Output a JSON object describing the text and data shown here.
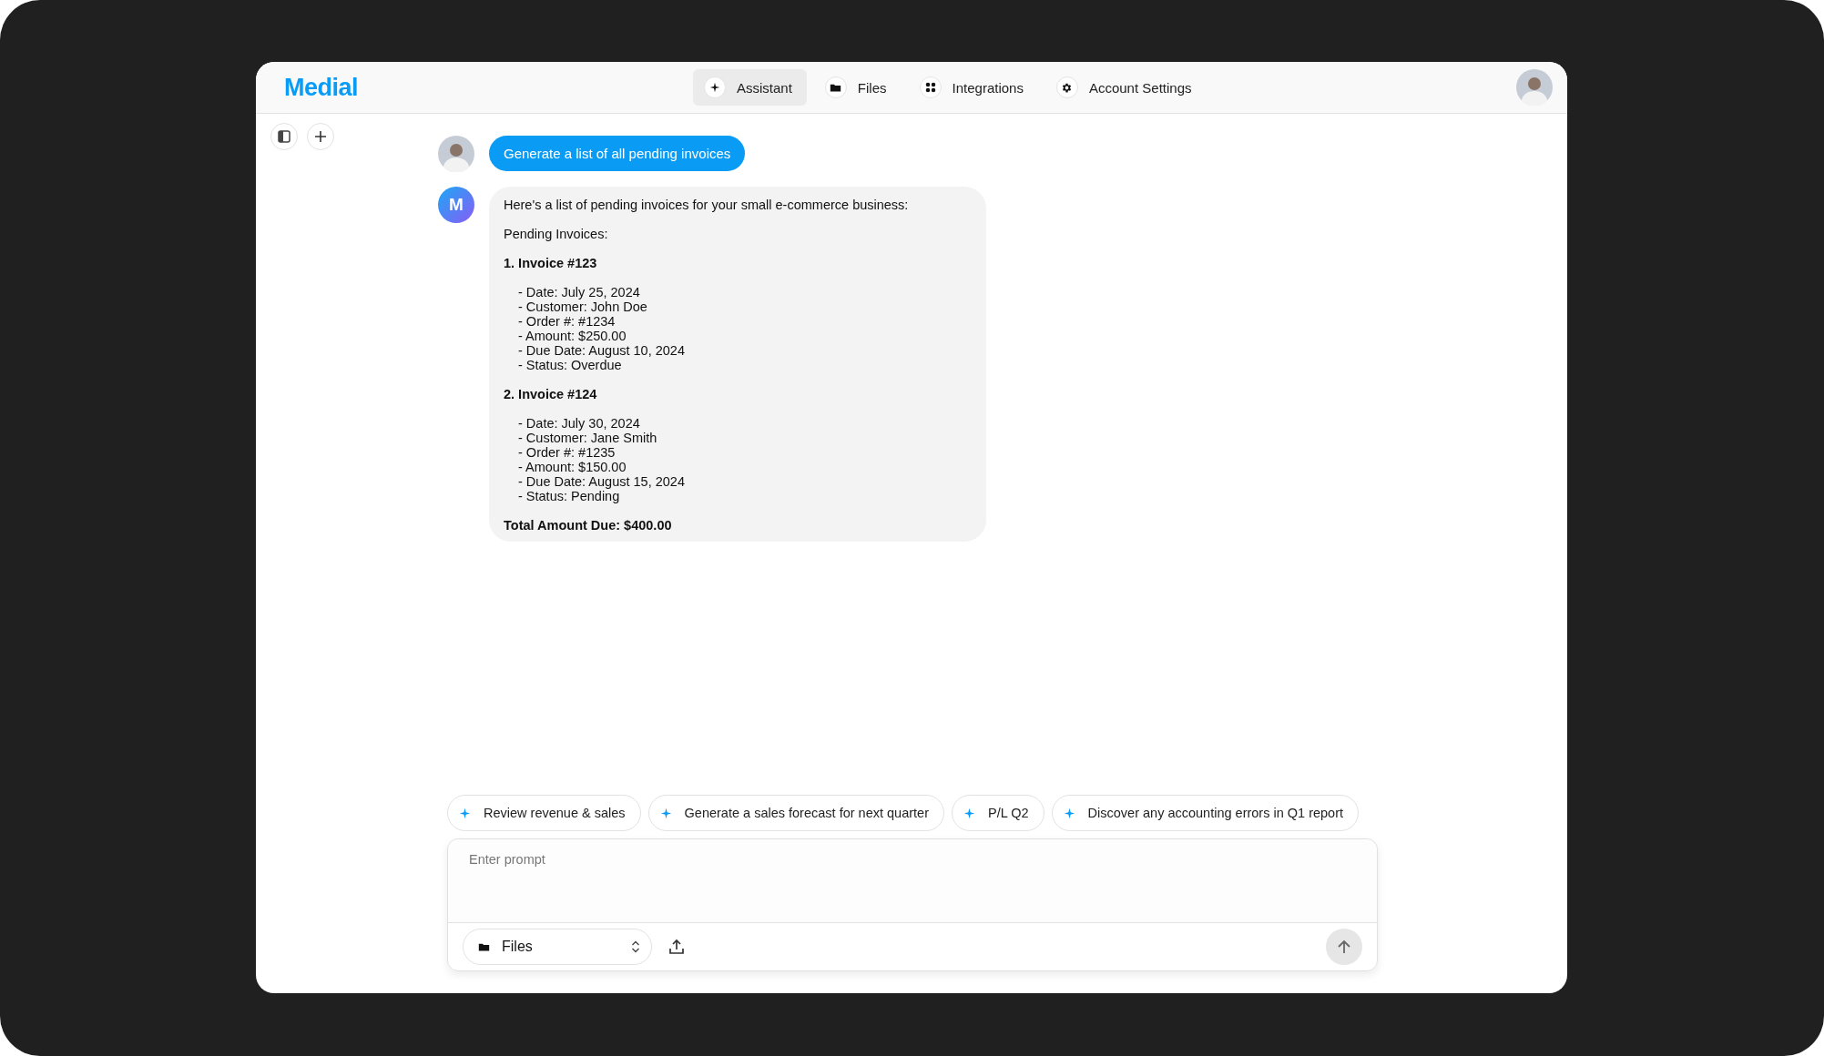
{
  "header": {
    "logo": "Medial",
    "nav": [
      {
        "label": "Assistant",
        "kind": "sparkle",
        "selected": true
      },
      {
        "label": "Files",
        "kind": "folder",
        "selected": false
      },
      {
        "label": "Integrations",
        "kind": "grid",
        "selected": false
      },
      {
        "label": "Account Settings",
        "kind": "gear",
        "selected": false
      }
    ]
  },
  "messages": [
    {
      "kind": "user",
      "text": "Generate a list of all pending invoices"
    },
    {
      "kind": "assistant",
      "avatar": "M",
      "blocks": [
        {
          "kind": "text",
          "text": "Here's a list of pending invoices for your small e-commerce business:"
        },
        {
          "kind": "text",
          "text": "Pending Invoices:"
        },
        {
          "kind": "heading",
          "text": "1. Invoice #123"
        },
        {
          "kind": "list",
          "items": [
            "- Date: July 25, 2024",
            "- Customer: John Doe",
            "- Order #: #1234",
            "- Amount: $250.00",
            "- Due Date: August 10, 2024",
            "- Status: Overdue"
          ]
        },
        {
          "kind": "heading",
          "text": "2. Invoice #124"
        },
        {
          "kind": "list",
          "items": [
            "- Date: July 30, 2024",
            "- Customer: Jane Smith",
            "- Order #: #1235",
            "- Amount: $150.00",
            "- Due Date: August 15, 2024",
            "- Status: Pending"
          ]
        },
        {
          "kind": "heading",
          "text": "Total Amount Due: $400.00"
        }
      ]
    }
  ],
  "suggestions": [
    "Review revenue & sales",
    "Generate a sales forecast for next quarter",
    "P/L Q2",
    "Discover any accounting errors in Q1 report"
  ],
  "composer": {
    "placeholder": "Enter prompt",
    "source": "Files",
    "send_disabled": true
  }
}
